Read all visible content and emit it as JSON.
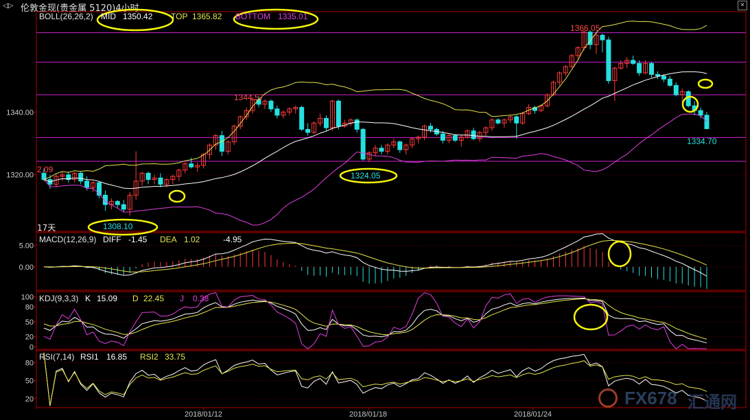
{
  "window": {
    "title": "伦敦金现(贵金属 5120)4小时",
    "nav_icon": "back-forward-icon",
    "close_icon": "close-icon"
  },
  "legends": {
    "boll": {
      "label": "BOLL(26,26,2)",
      "mid_label": "MID",
      "mid_value": "1350.42",
      "top_label": "TOP",
      "top_value": "1365.82",
      "bottom_label": "BOTTOM",
      "bottom_value": "1335.01"
    },
    "macd": {
      "label": "MACD(12,26,9)",
      "diff_label": "DIFF",
      "diff_value": "-1.45",
      "dea_label": "DEA",
      "dea_value": "1.02",
      "macd_value": "-4.95"
    },
    "kdj": {
      "label": "KDJ(9,3,3)",
      "k_label": "K",
      "k_value": "15.09",
      "d_label": "D",
      "d_value": "22.45",
      "j_label": "J",
      "j_value": "0.38"
    },
    "rsi": {
      "label": "RSI(7,14)",
      "rsi1_label": "RSI1",
      "rsi1_value": "16.85",
      "rsi2_label": "RSI2",
      "rsi2_value": "33.75"
    }
  },
  "annotations": {
    "high": "1366.05",
    "peak_left": "1344.57",
    "trough_mid": "1324.05",
    "trough_left": "1308.10",
    "last": "1334.70",
    "left_edge": "2.09",
    "days": "17天"
  },
  "dates": [
    "2018/01/12",
    "2018/01/18",
    "2018/01/24"
  ],
  "watermark": {
    "brand": "FX678",
    "cn": "汇通网"
  },
  "colors": {
    "bull": "#ff3b3b",
    "bear": "#26e0e0",
    "mid": "#ffffff",
    "upper": "#e6e64a",
    "lower": "#e040e0",
    "hline": "#d020d0",
    "highlight": "#f5f50a",
    "grid": "#7a0000"
  },
  "chart_data": [
    {
      "type": "candlestick",
      "name": "price",
      "yticks": [
        1320.0,
        1340.0
      ],
      "ylim": [
        1302,
        1372
      ],
      "horizontal_lines": [
        1365.3,
        1355.9,
        1345.5,
        1331.9,
        1324.3
      ],
      "candles": [
        [
          1320.5,
          1322.0,
          1318.0,
          1318.5
        ],
        [
          1318.5,
          1320.0,
          1315.5,
          1317.0
        ],
        [
          1317.0,
          1320.5,
          1316.0,
          1319.5
        ],
        [
          1319.5,
          1321.0,
          1318.0,
          1320.0
        ],
        [
          1320.0,
          1321.0,
          1317.5,
          1318.5
        ],
        [
          1318.5,
          1321.0,
          1317.5,
          1320.5
        ],
        [
          1320.5,
          1321.0,
          1317.0,
          1318.0
        ],
        [
          1318.0,
          1319.5,
          1315.0,
          1316.0
        ],
        [
          1316.0,
          1318.0,
          1314.5,
          1317.5
        ],
        [
          1317.5,
          1318.0,
          1312.5,
          1313.5
        ],
        [
          1313.5,
          1315.0,
          1308.5,
          1310.5
        ],
        [
          1310.5,
          1312.5,
          1309.0,
          1311.5
        ],
        [
          1311.5,
          1312.0,
          1309.5,
          1310.5
        ],
        [
          1310.5,
          1312.0,
          1308.0,
          1309.0
        ],
        [
          1309.0,
          1314.5,
          1307.0,
          1313.5
        ],
        [
          1313.5,
          1327.5,
          1312.0,
          1318.0
        ],
        [
          1318.0,
          1321.0,
          1316.5,
          1320.5
        ],
        [
          1320.5,
          1321.0,
          1317.0,
          1318.5
        ],
        [
          1318.5,
          1320.0,
          1317.0,
          1319.0
        ],
        [
          1319.0,
          1320.5,
          1316.0,
          1317.0
        ],
        [
          1317.0,
          1319.0,
          1316.0,
          1318.5
        ],
        [
          1318.5,
          1320.0,
          1317.0,
          1319.5
        ],
        [
          1319.5,
          1322.0,
          1318.0,
          1321.5
        ],
        [
          1321.5,
          1324.0,
          1320.5,
          1323.5
        ],
        [
          1323.5,
          1325.5,
          1322.0,
          1322.5
        ],
        [
          1322.5,
          1324.0,
          1321.0,
          1323.0
        ],
        [
          1323.0,
          1327.0,
          1322.0,
          1326.5
        ],
        [
          1326.5,
          1330.0,
          1325.0,
          1329.5
        ],
        [
          1329.5,
          1333.0,
          1328.0,
          1332.5
        ],
        [
          1332.5,
          1334.0,
          1326.0,
          1327.5
        ],
        [
          1327.5,
          1331.0,
          1326.5,
          1330.5
        ],
        [
          1330.5,
          1336.0,
          1329.5,
          1335.5
        ],
        [
          1335.5,
          1339.0,
          1334.5,
          1338.5
        ],
        [
          1338.5,
          1341.5,
          1337.5,
          1340.5
        ],
        [
          1340.5,
          1344.6,
          1339.5,
          1344.0
        ],
        [
          1344.0,
          1345.0,
          1341.5,
          1342.5
        ],
        [
          1342.5,
          1344.0,
          1341.0,
          1343.5
        ],
        [
          1343.5,
          1344.0,
          1340.0,
          1341.0
        ],
        [
          1341.0,
          1342.0,
          1338.0,
          1339.0
        ],
        [
          1339.0,
          1340.5,
          1338.0,
          1340.0
        ],
        [
          1340.0,
          1341.5,
          1339.0,
          1341.0
        ],
        [
          1341.0,
          1342.0,
          1339.5,
          1341.5
        ],
        [
          1341.5,
          1342.0,
          1334.0,
          1334.5
        ],
        [
          1334.5,
          1336.5,
          1332.5,
          1333.5
        ],
        [
          1333.5,
          1337.0,
          1333.0,
          1336.5
        ],
        [
          1336.5,
          1339.5,
          1335.5,
          1338.0
        ],
        [
          1338.0,
          1339.0,
          1334.0,
          1335.0
        ],
        [
          1335.0,
          1344.0,
          1334.0,
          1343.5
        ],
        [
          1343.5,
          1344.0,
          1334.5,
          1335.5
        ],
        [
          1335.5,
          1337.5,
          1335.0,
          1336.5
        ],
        [
          1336.5,
          1338.0,
          1335.5,
          1337.5
        ],
        [
          1337.5,
          1338.0,
          1333.5,
          1334.5
        ],
        [
          1334.5,
          1335.0,
          1324.5,
          1325.0
        ],
        [
          1325.0,
          1327.5,
          1324.0,
          1327.0
        ],
        [
          1327.0,
          1329.5,
          1326.0,
          1328.5
        ],
        [
          1328.5,
          1329.5,
          1326.5,
          1327.5
        ],
        [
          1327.5,
          1330.0,
          1326.5,
          1329.5
        ],
        [
          1329.5,
          1331.5,
          1328.5,
          1330.5
        ],
        [
          1330.5,
          1331.0,
          1327.0,
          1328.0
        ],
        [
          1328.0,
          1330.0,
          1326.5,
          1329.5
        ],
        [
          1329.5,
          1332.0,
          1328.5,
          1331.5
        ],
        [
          1331.5,
          1332.5,
          1330.0,
          1332.0
        ],
        [
          1332.0,
          1336.0,
          1331.0,
          1335.5
        ],
        [
          1335.5,
          1336.5,
          1333.5,
          1334.5
        ],
        [
          1334.5,
          1335.0,
          1332.5,
          1333.0
        ],
        [
          1333.0,
          1334.0,
          1330.0,
          1331.0
        ],
        [
          1331.0,
          1333.0,
          1330.0,
          1332.5
        ],
        [
          1332.5,
          1333.0,
          1330.5,
          1331.0
        ],
        [
          1331.0,
          1333.0,
          1329.0,
          1332.0
        ],
        [
          1332.0,
          1334.5,
          1331.5,
          1334.0
        ],
        [
          1334.0,
          1335.0,
          1331.0,
          1331.5
        ],
        [
          1331.5,
          1334.0,
          1330.5,
          1333.5
        ],
        [
          1333.5,
          1335.5,
          1332.5,
          1335.0
        ],
        [
          1335.0,
          1338.0,
          1334.0,
          1337.5
        ],
        [
          1337.5,
          1338.0,
          1336.0,
          1336.5
        ],
        [
          1336.5,
          1338.0,
          1335.0,
          1337.5
        ],
        [
          1337.5,
          1339.0,
          1336.5,
          1338.5
        ],
        [
          1338.5,
          1339.0,
          1331.5,
          1336.5
        ],
        [
          1336.5,
          1340.0,
          1336.0,
          1339.5
        ],
        [
          1339.5,
          1342.5,
          1339.0,
          1341.5
        ],
        [
          1341.5,
          1342.0,
          1339.5,
          1340.5
        ],
        [
          1340.5,
          1342.5,
          1340.0,
          1342.0
        ],
        [
          1342.0,
          1346.0,
          1341.5,
          1345.5
        ],
        [
          1345.5,
          1350.0,
          1345.0,
          1349.5
        ],
        [
          1349.5,
          1353.0,
          1348.5,
          1352.5
        ],
        [
          1352.5,
          1355.0,
          1351.5,
          1354.5
        ],
        [
          1354.5,
          1358.5,
          1354.0,
          1358.0
        ],
        [
          1358.0,
          1361.0,
          1357.0,
          1360.5
        ],
        [
          1360.5,
          1366.1,
          1359.5,
          1365.5
        ],
        [
          1365.5,
          1366.0,
          1360.0,
          1361.5
        ],
        [
          1361.5,
          1365.5,
          1358.5,
          1364.5
        ],
        [
          1364.5,
          1365.0,
          1359.0,
          1363.0
        ],
        [
          1363.0,
          1364.0,
          1349.0,
          1350.0
        ],
        [
          1350.0,
          1354.5,
          1343.5,
          1354.0
        ],
        [
          1354.0,
          1356.5,
          1353.5,
          1355.5
        ],
        [
          1355.5,
          1357.5,
          1354.0,
          1356.5
        ],
        [
          1356.5,
          1358.0,
          1355.0,
          1355.5
        ],
        [
          1355.5,
          1356.5,
          1351.5,
          1352.5
        ],
        [
          1352.5,
          1356.5,
          1352.0,
          1355.5
        ],
        [
          1355.5,
          1356.0,
          1351.0,
          1352.0
        ],
        [
          1352.0,
          1353.0,
          1350.5,
          1351.5
        ],
        [
          1351.5,
          1352.0,
          1349.5,
          1350.5
        ],
        [
          1350.5,
          1351.5,
          1348.0,
          1348.5
        ],
        [
          1348.5,
          1349.5,
          1345.0,
          1345.5
        ],
        [
          1345.5,
          1347.5,
          1343.0,
          1346.5
        ],
        [
          1346.5,
          1347.0,
          1341.5,
          1342.0
        ],
        [
          1342.0,
          1343.5,
          1339.0,
          1340.5
        ],
        [
          1340.5,
          1341.5,
          1338.0,
          1339.0
        ],
        [
          1339.0,
          1340.0,
          1334.5,
          1334.7
        ]
      ]
    },
    {
      "type": "line+bar",
      "name": "MACD",
      "yticks": [
        0.0,
        5.0
      ],
      "ylim": [
        -5.5,
        8
      ]
    },
    {
      "type": "line",
      "name": "KDJ",
      "yticks": [
        0,
        20,
        50,
        80,
        100
      ],
      "ylim": [
        -5,
        110
      ]
    },
    {
      "type": "line",
      "name": "RSI",
      "yticks": [
        20,
        50,
        80
      ],
      "ylim": [
        5,
        100
      ]
    }
  ]
}
